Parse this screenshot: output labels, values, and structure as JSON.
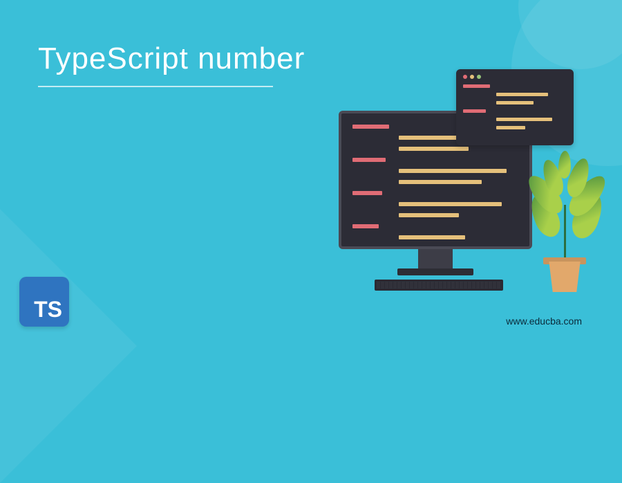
{
  "title": "TypeScript number",
  "ts_badge_text": "TS",
  "site_url": "www.educba.com",
  "colors": {
    "background": "#3abfd8",
    "code_bg": "#2c2c36",
    "red_line": "#e06c75",
    "yellow_line": "#e5c07b",
    "ts_blue": "#2f74c0",
    "pot": "#e2a86b"
  },
  "window_dots": [
    "red",
    "yellow",
    "green"
  ],
  "monitor_code_lines": [
    {
      "color": "#e06c75",
      "width": "22%",
      "indent": "0"
    },
    {
      "color": "#e5c07b",
      "width": "60%",
      "indent": "28%"
    },
    {
      "color": "#e5c07b",
      "width": "42%",
      "indent": "28%"
    },
    {
      "color": "#e06c75",
      "width": "20%",
      "indent": "0"
    },
    {
      "color": "#e5c07b",
      "width": "65%",
      "indent": "28%"
    },
    {
      "color": "#e5c07b",
      "width": "50%",
      "indent": "28%"
    },
    {
      "color": "#e06c75",
      "width": "18%",
      "indent": "0"
    },
    {
      "color": "#e5c07b",
      "width": "62%",
      "indent": "28%"
    },
    {
      "color": "#e5c07b",
      "width": "36%",
      "indent": "28%"
    },
    {
      "color": "#e06c75",
      "width": "16%",
      "indent": "0"
    },
    {
      "color": "#e5c07b",
      "width": "40%",
      "indent": "28%"
    }
  ],
  "float_code_lines": [
    {
      "color": "#e06c75",
      "width": "26%",
      "indent": "0"
    },
    {
      "color": "#e5c07b",
      "width": "50%",
      "indent": "32%"
    },
    {
      "color": "#e5c07b",
      "width": "36%",
      "indent": "32%"
    },
    {
      "color": "#e06c75",
      "width": "22%",
      "indent": "0"
    },
    {
      "color": "#e5c07b",
      "width": "54%",
      "indent": "32%"
    },
    {
      "color": "#e5c07b",
      "width": "28%",
      "indent": "32%"
    }
  ]
}
